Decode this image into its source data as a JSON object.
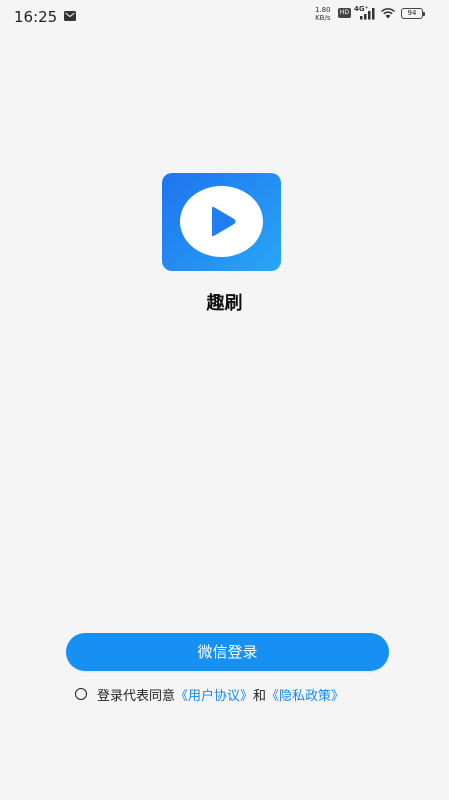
{
  "status_bar": {
    "time": "16:25",
    "net_speed_value": "1.80",
    "net_speed_unit": "KB/s",
    "hd_label": "HD",
    "network_label": "4G⁺",
    "battery_level": "94"
  },
  "app": {
    "name": "趣刷",
    "logo_color_start": "#1f74ee",
    "logo_color_end": "#28a6f6"
  },
  "login": {
    "wechat_button_label": "微信登录",
    "button_color": "#1790f3"
  },
  "agreement": {
    "prefix": "登录代表同意",
    "user_agreement_link": "《用户协议》",
    "conjunction": "和",
    "privacy_policy_link": "《隐私政策》",
    "link_color": "#1789e8"
  }
}
